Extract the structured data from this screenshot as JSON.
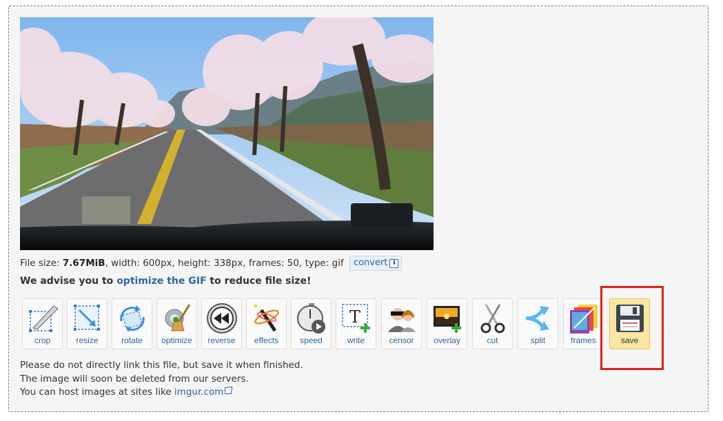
{
  "fileinfo": {
    "prefix": "File size: ",
    "size": "7.67MiB",
    "rest": ", width: 600px, height: 338px, frames: 50, type: gif",
    "convert_label": "convert"
  },
  "advice": {
    "before": "We advise you to ",
    "link": "optimize the GIF",
    "after": " to reduce file size!"
  },
  "tools": [
    {
      "label": "crop",
      "icon": "crop-icon"
    },
    {
      "label": "resize",
      "icon": "resize-icon"
    },
    {
      "label": "rotate",
      "icon": "rotate-icon"
    },
    {
      "label": "optimize",
      "icon": "broom-icon"
    },
    {
      "label": "reverse",
      "icon": "rewind-icon"
    },
    {
      "label": "effects",
      "icon": "magic-wand-icon"
    },
    {
      "label": "speed",
      "icon": "stopwatch-icon"
    },
    {
      "label": "write",
      "icon": "text-icon"
    },
    {
      "label": "censor",
      "icon": "censor-icon"
    },
    {
      "label": "overlay",
      "icon": "overlay-image-icon"
    },
    {
      "label": "cut",
      "icon": "scissors-icon"
    },
    {
      "label": "split",
      "icon": "split-arrows-icon"
    },
    {
      "label": "frames",
      "icon": "frames-icon"
    },
    {
      "label": "save",
      "icon": "floppy-disk-icon"
    }
  ],
  "active_tool": "save",
  "notes": {
    "line1": "Please do not directly link this file, but save it when finished.",
    "line2": "The image will soon be deleted from our servers.",
    "line3_prefix": "You can host images at sites like ",
    "line3_link": "imgur.com"
  },
  "colors": {
    "link": "#2d66a6",
    "highlight_border": "#e0201e",
    "active_tool_bg": "#fbe7a1"
  }
}
